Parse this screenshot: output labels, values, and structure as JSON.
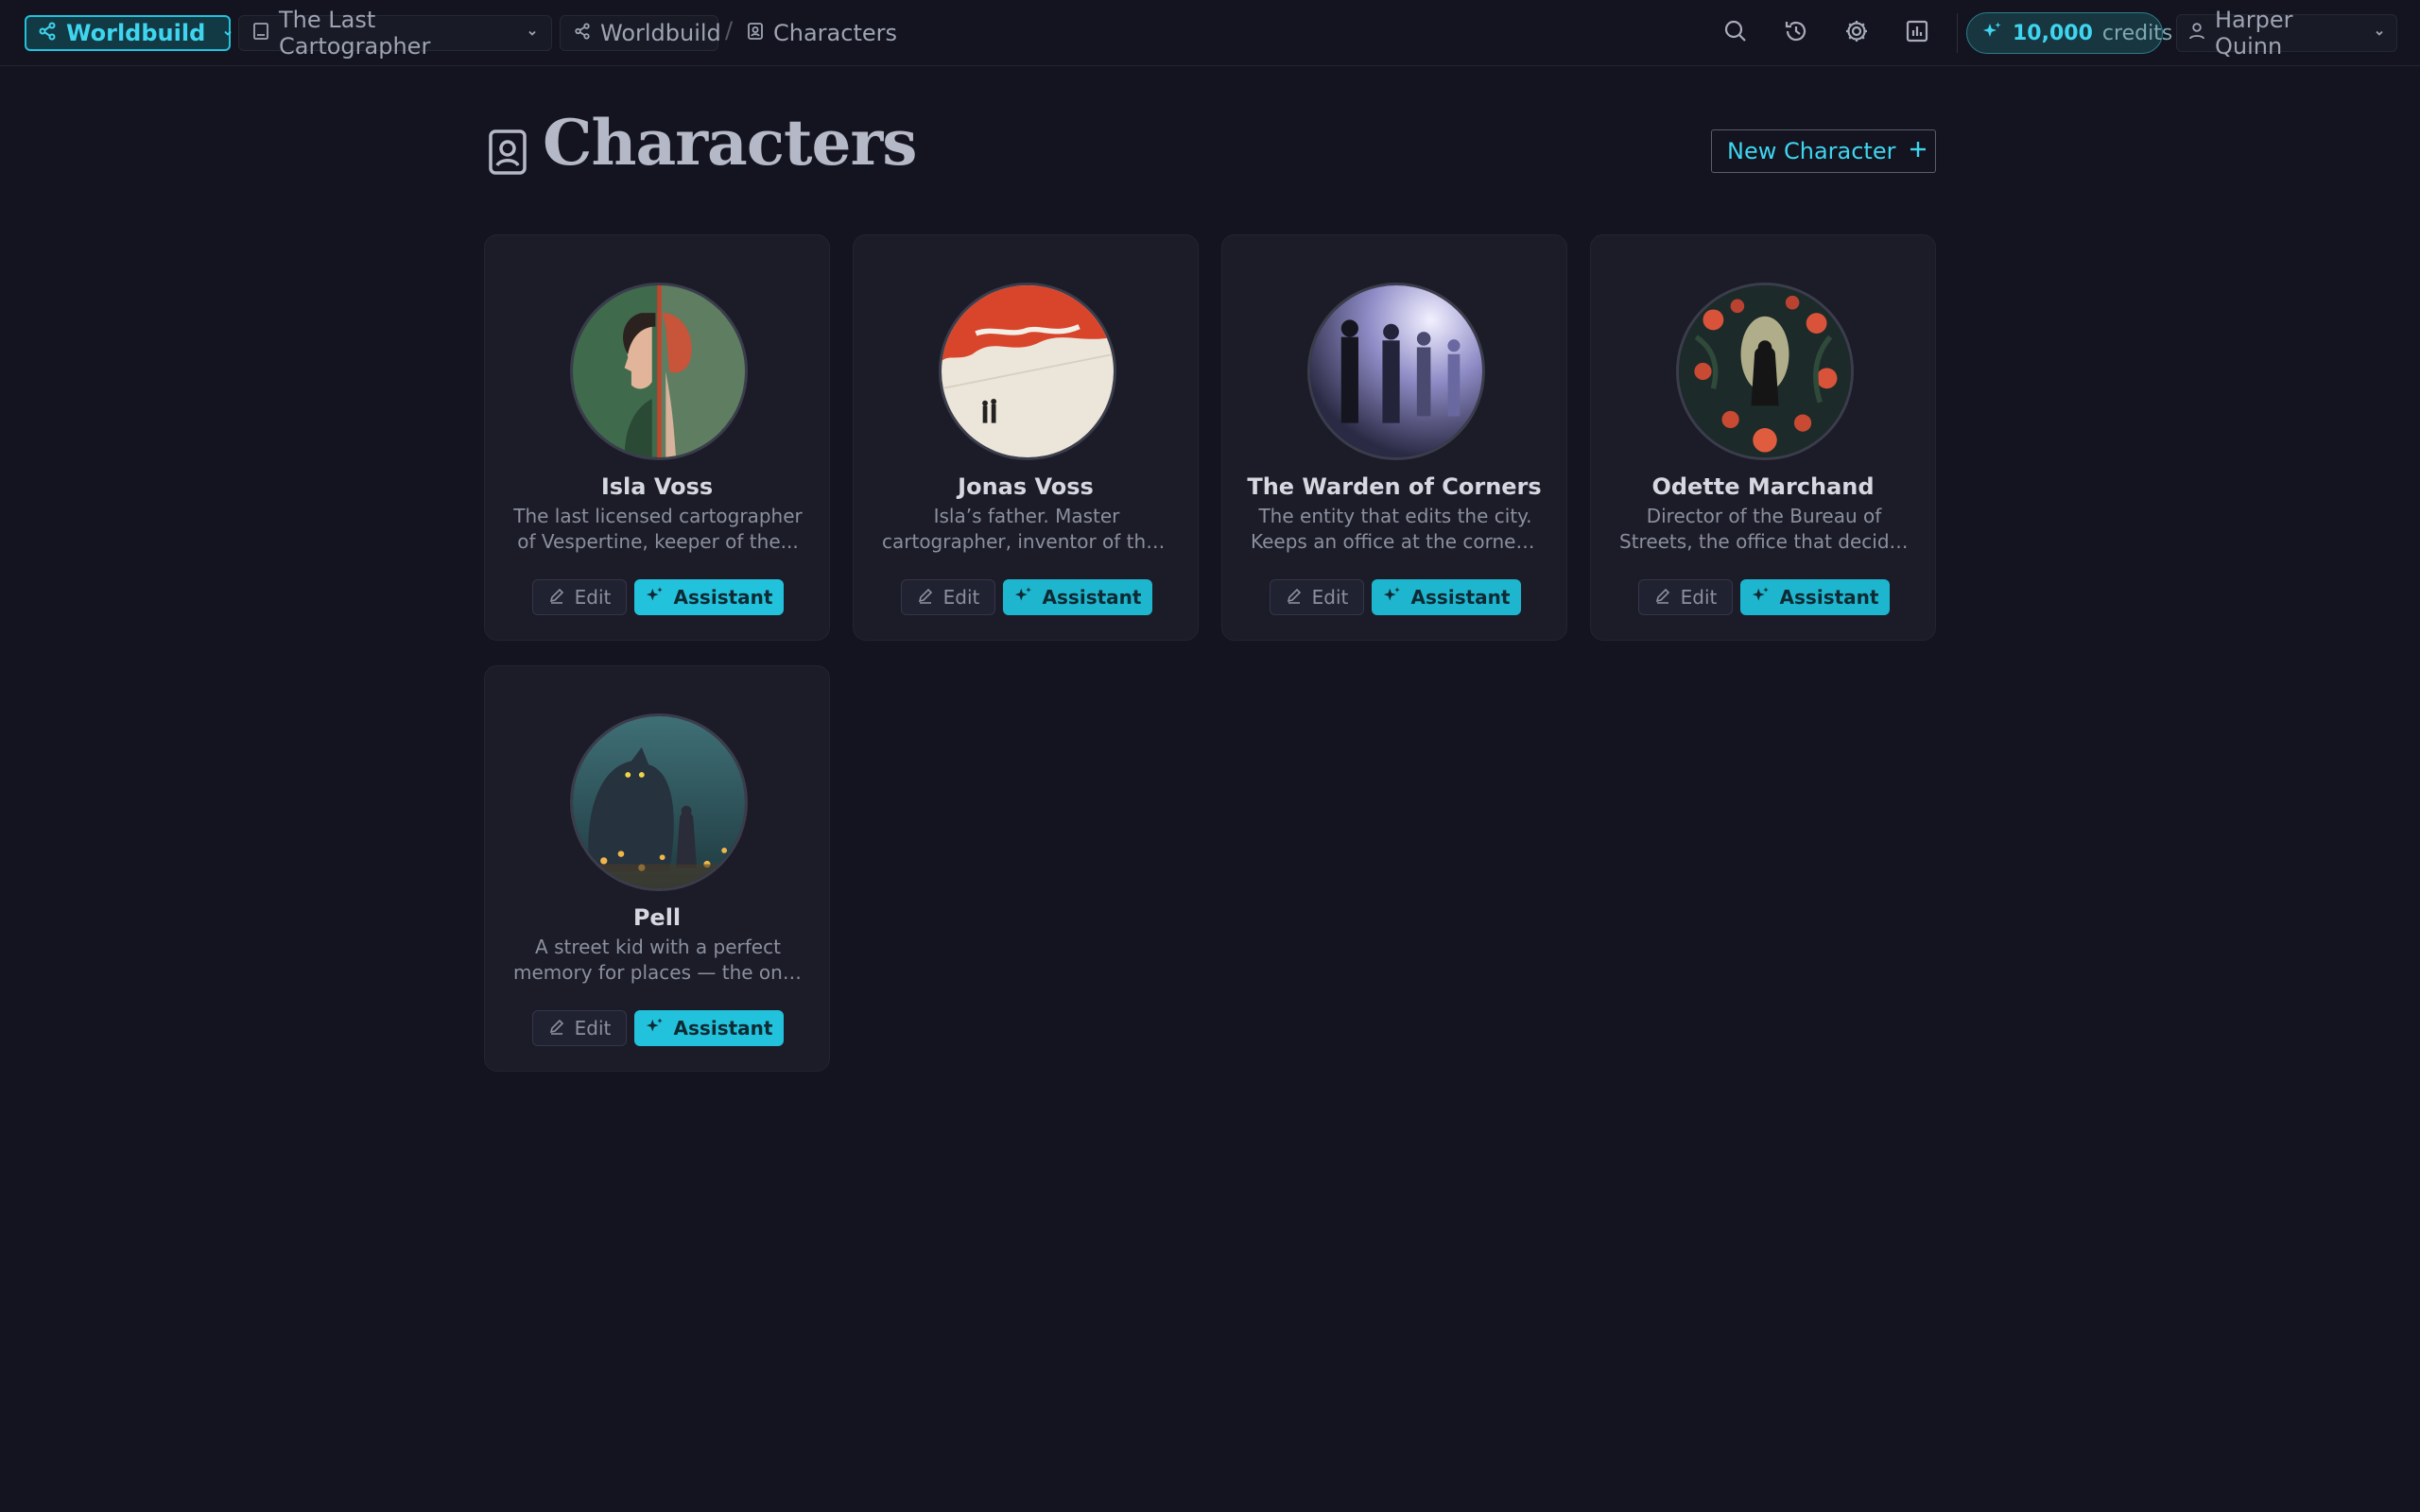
{
  "topbar": {
    "brand_label": "Worldbuild",
    "project_label": "The Last Cartographer",
    "world_label": "Worldbuild",
    "separator": "/",
    "section_label": "Characters",
    "credits_value": "10,000",
    "credits_unit": "credits",
    "user_name": "Harper Quinn"
  },
  "page": {
    "title": "Characters",
    "new_button_label": "New Character"
  },
  "card_actions": {
    "edit_label": "Edit",
    "assistant_label": "Assistant"
  },
  "characters": [
    {
      "name": "Isla Voss",
      "desc_line1": "The last licensed cartographer",
      "desc_line2": "of Vespertine, keeper of the..."
    },
    {
      "name": "Jonas Voss",
      "desc_line1": "Isla’s father. Master",
      "desc_line2": "cartographer, inventor of the..."
    },
    {
      "name": "The Warden of Corners",
      "desc_line1": "The entity that edits the city.",
      "desc_line2": "Keeps an office at the corner ..."
    },
    {
      "name": "Odette Marchand",
      "desc_line1": "Director of the Bureau of",
      "desc_line2": "Streets, the office that decide..."
    },
    {
      "name": "Pell",
      "desc_line1": "A street kid with a perfect",
      "desc_line2": "memory for places — the only..."
    }
  ],
  "colors": {
    "accent": "#22c2dd",
    "background": "#13141f",
    "card": "#1b1c28"
  },
  "icons": {
    "brand": "share-nodes-icon",
    "project": "book-icon",
    "section": "portrait-icon",
    "search": "search-icon",
    "history": "history-icon",
    "settings": "gear-icon",
    "stats": "bar-chart-icon",
    "credits": "sparkles-icon",
    "user": "user-icon",
    "edit": "pencil-icon",
    "assistant": "sparkles-icon",
    "new": "plus-icon"
  }
}
